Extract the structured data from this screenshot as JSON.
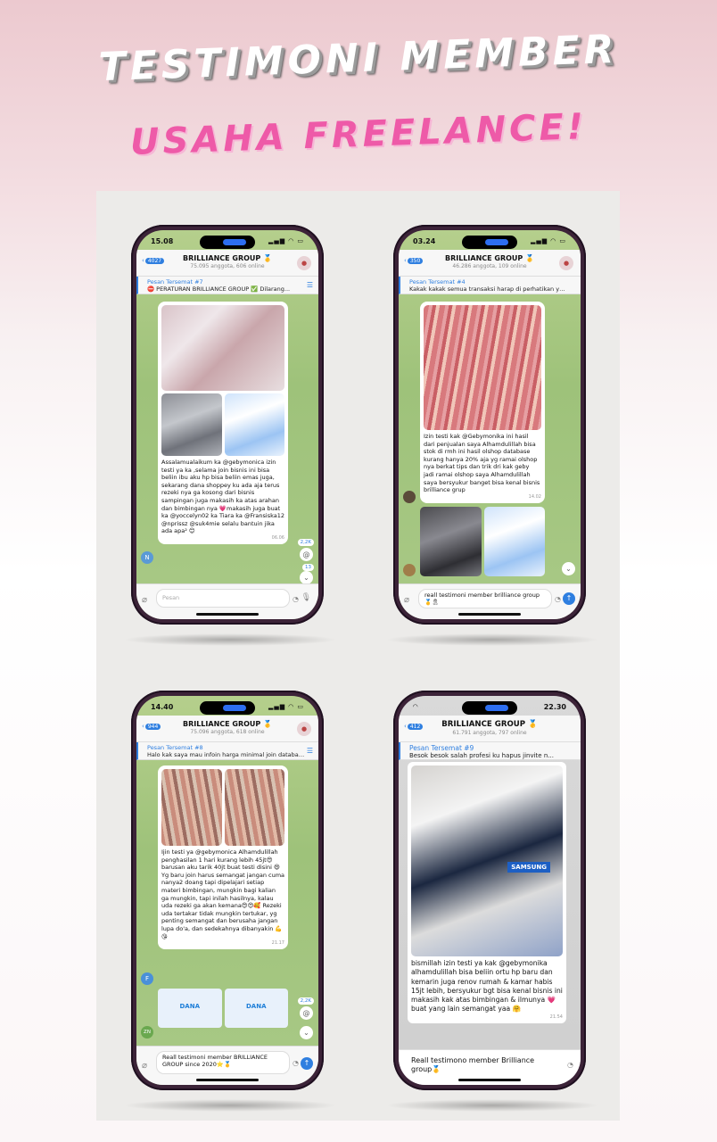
{
  "headline": {
    "line1": "TESTIMONI MEMBER",
    "line2": "USAHA FREELANCE!"
  },
  "colors": {
    "accent_pink": "#ee5aa8",
    "telegram_blue": "#2f7fe0",
    "chat_bg": "#a9c986"
  },
  "phones": [
    {
      "time": "15.08",
      "back_count": "4027",
      "chat_title": "BRILLIANCE GROUP 🥇",
      "chat_sub": "75.095 anggota, 606 online",
      "pinned_label": "Pesan Tersemat #7",
      "pinned_text": "⛔ PERATURAN BRILLIANCE GROUP ✅ Dilarang...",
      "message": "Assalamualaikum ka @gebymonica izin testi ya ka ,selama join bisnis ini bisa beliin ibu aku hp bisa beliin emas juga, sekarang dana shoppey ku ada aja terus rezeki nya ga kosong dari bisnis sampingan juga makasih ka atas arahan dan bimbingan nya 💗makasih juga buat ka @yoccelyn02 ka Tiara ka @Fransiska12 @nprissz @suk4mie selalu bantuin jika ada apa² 😊",
      "time_stamp": "06.06",
      "side_avatar": "N",
      "badge1": "2,2K",
      "badge2": "13",
      "input_placeholder": "Pesan"
    },
    {
      "time": "03.24",
      "back_count": "350",
      "chat_title": "BRILLIANCE GROUP 🥇",
      "chat_sub": "46.286 anggota, 109 online",
      "pinned_label": "Pesan Tersemat #4",
      "pinned_text": "Kakak kakak semua transaksi harap di perhatikan yaa...",
      "message": "Izin testi kak @Gebymonika ini hasil dari penjualan saya Alhamdulillah bisa stok di rmh ini hasil olshop database kurang hanya 20% aja yg ramai olshop nya berkat tips dan trik dri kak geby jadi ramai olshop saya Alhamdulillah saya bersyukur banget bisa kenal bisnis brilliance grup",
      "time_stamp": "14.02",
      "input_text": "reall testimoni member brilliance group 🥇🎗"
    },
    {
      "time": "14.40",
      "back_count": "944",
      "chat_title": "BRILLIANCE GROUP 🥇",
      "chat_sub": "75.096 anggota, 618 online",
      "pinned_label": "Pesan Tersemat #8",
      "pinned_text": "Halo kak saya mau infoin harga minimal join database...",
      "message": "Ijin testi ya @gebymonica Alhamdulillah penghasilan 1 hari kurang lebih 45jt😍 barusan aku tarik 40jt buat testi disini 😄 Yg baru join harus semangat jangan cuma nanya2 doang tapi dipelajari setiap materi bimbingan, mungkin bagi kalian ga mungkin, tapi inilah hasilnya, kalau uda rezeki ga akan kemana😍😍🥰 Rezeki uda tertakar tidak mungkin tertukar, yg penting semangat dan berusaha jangan lupa do'a, dan sedekahnya dibanyakin 💪😘",
      "time_stamp": "21.17",
      "side_avatar": "F",
      "side_avatar2": "ZN",
      "badge1": "2,2K",
      "dana_label": "DANA",
      "input_text": "Reall testimoni member BRILLIANCE GROUP since 2020⭐🥇"
    },
    {
      "time": "22.30",
      "back_count": "412",
      "chat_title": "BRILLIANCE GROUP 🥇",
      "chat_sub": "61.791 anggota, 797 online",
      "pinned_label": "Pesan Tersemat #9",
      "pinned_text": "Besok besok salah profesi ku hapus jinvite n...",
      "message": "bismillah izin testi ya kak @gebymonika alhamdulillah bisa beliin ortu hp baru dan kemarin juga renov rumah & kamar habis 15jt lebih, bersyukur bgt bisa kenal bisnis ini makasih kak atas bimbingan & ilmunya 💗 buat yang lain semangat yaa 🤗",
      "time_stamp": "21.54",
      "photo_caption": "SAMSUNG",
      "input_text": "Reall testimono member Brilliance group🥇"
    }
  ]
}
